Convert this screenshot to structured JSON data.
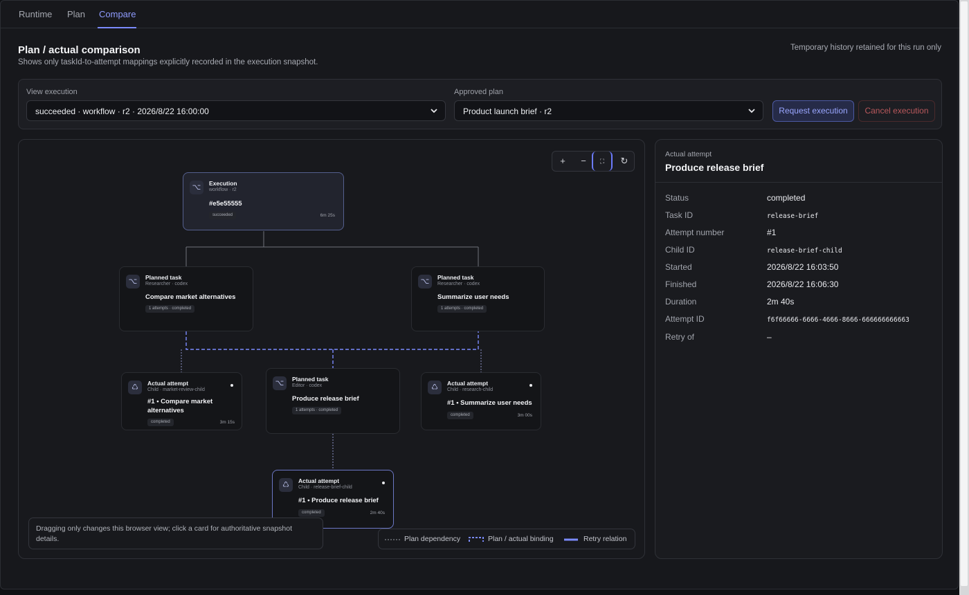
{
  "tabs": [
    {
      "label": "Runtime"
    },
    {
      "label": "Plan"
    },
    {
      "label": "Compare",
      "active": true
    }
  ],
  "header": {
    "title": "Plan / actual comparison",
    "subtitle": "Shows only taskId-to-attempt mappings explicitly recorded in the execution snapshot.",
    "history_note": "Temporary history retained for this run only"
  },
  "controls": {
    "execution_label": "View execution",
    "execution_value": "succeeded · workflow · r2 · 2026/8/22 16:00:00",
    "plan_label": "Approved plan",
    "plan_value": "Product launch brief · r2",
    "request_button": "Request execution",
    "cancel_button": "Cancel execution"
  },
  "zoom": {
    "zoom_in": "+",
    "zoom_out": "−",
    "fit": "⛶",
    "reset": "↻"
  },
  "graph": {
    "execution": {
      "kind": "Execution",
      "meta": "workflow · r2",
      "title": "#e5e55555",
      "status": "succeeded",
      "duration": "6m 25s"
    },
    "planned": [
      {
        "kind": "Planned task",
        "meta": "Researcher · codex",
        "title": "Compare market alternatives",
        "pill": "1 attempts · completed"
      },
      {
        "kind": "Planned task",
        "meta": "Researcher · codex",
        "title": "Summarize user needs",
        "pill": "1 attempts · completed"
      },
      {
        "kind": "Planned task",
        "meta": "Editor · codex",
        "title": "Produce release brief",
        "pill": "1 attempts · completed"
      }
    ],
    "attempts": [
      {
        "kind": "Actual attempt",
        "meta": "Child · market-review-child",
        "title_line1": "#1 • Compare market",
        "title_line2": "alternatives",
        "status": "completed",
        "duration": "3m 15s"
      },
      {
        "kind": "Actual attempt",
        "meta": "Child · research-child",
        "title_line1": "#1 • Summarize user needs",
        "status": "completed",
        "duration": "3m 00s"
      },
      {
        "kind": "Actual attempt",
        "meta": "Child · release-brief-child",
        "title_line1": "#1 • Produce release brief",
        "status": "completed",
        "duration": "2m 40s"
      }
    ],
    "note": "Dragging only changes this browser view; click a card for authoritative snapshot details.",
    "legend": {
      "dependency": "Plan dependency",
      "binding": "Plan / actual binding",
      "retry": "Retry relation"
    },
    "colors": {
      "accent": "#7b8bff",
      "edge": "#6f737c"
    }
  },
  "detail": {
    "kind": "Actual attempt",
    "title": "Produce release brief",
    "rows": [
      {
        "key": "Status",
        "value": "completed",
        "mono": false
      },
      {
        "key": "Task ID",
        "value": "release-brief",
        "mono": true
      },
      {
        "key": "Attempt number",
        "value": "#1",
        "mono": false
      },
      {
        "key": "Child ID",
        "value": "release-brief-child",
        "mono": true
      },
      {
        "key": "Started",
        "value": "2026/8/22 16:03:50",
        "mono": false
      },
      {
        "key": "Finished",
        "value": "2026/8/22 16:06:30",
        "mono": false
      },
      {
        "key": "Duration",
        "value": "2m 40s",
        "mono": false
      },
      {
        "key": "Attempt ID",
        "value": "f6f66666-6666-4666-8666-666666666663",
        "mono": true
      },
      {
        "key": "Retry of",
        "value": "–",
        "mono": false
      }
    ]
  }
}
